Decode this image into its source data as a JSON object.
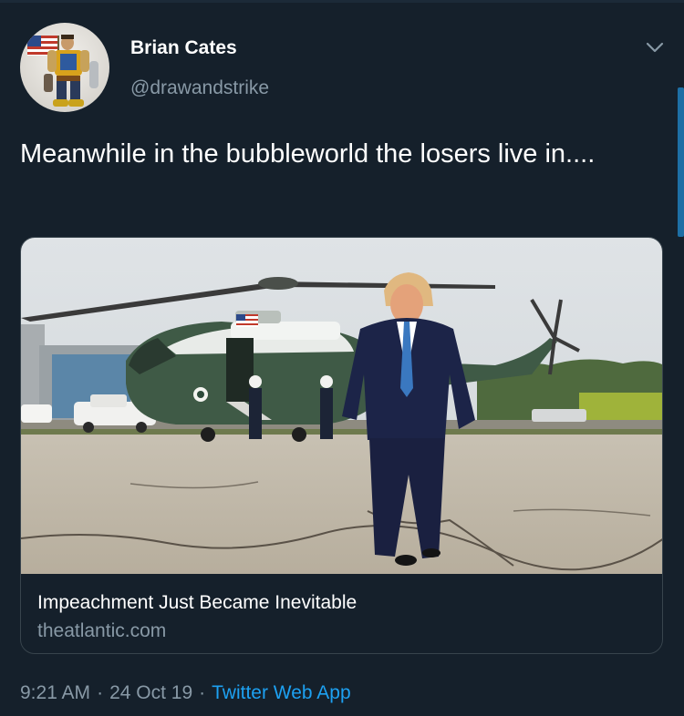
{
  "author": {
    "display_name": "Brian Cates",
    "handle": "@drawandstrike",
    "avatar_icon": "action-figure-avatar"
  },
  "tweet": {
    "text": "Meanwhile in the bubbleworld the losers live in...."
  },
  "card": {
    "image_icon": "news-photo-helicopter-man-walking",
    "title": "Impeachment Just Became Inevitable",
    "domain": "theatlantic.com"
  },
  "meta": {
    "time": "9:21 AM",
    "separator": "·",
    "date": "24 Oct 19",
    "source": "Twitter Web App"
  },
  "colors": {
    "background": "#15202b",
    "primary_text": "#ffffff",
    "secondary_text": "#8899a6",
    "link": "#1da1f2"
  }
}
